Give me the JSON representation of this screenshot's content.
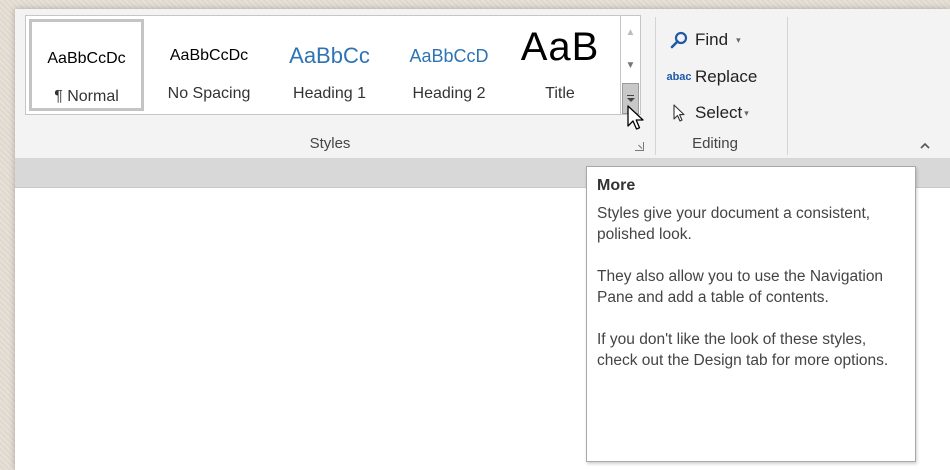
{
  "styles_gallery": {
    "tiles": [
      {
        "sample": "AaBbCcDc",
        "label": "¶ Normal",
        "selected": true
      },
      {
        "sample": "AaBbCcDc",
        "label": "No Spacing"
      },
      {
        "sample": "AaBbCc",
        "label": "Heading 1"
      },
      {
        "sample": "AaBbCcD",
        "label": "Heading 2"
      },
      {
        "sample": "AaB",
        "label": "Title"
      }
    ],
    "scroll_up_glyph": "▲",
    "scroll_down_glyph": "▼",
    "group_label": "Styles"
  },
  "editing": {
    "find_label": "Find",
    "replace_label": "Replace",
    "select_label": "Select",
    "caret_glyph": "▾",
    "replace_icon_top": "ab",
    "replace_icon_bottom": "ac",
    "group_label": "Editing"
  },
  "tooltip": {
    "title": "More",
    "paragraphs": [
      "Styles give your document a consistent, polished look.",
      "They also allow you to use the Navigation Pane and add a table of contents.",
      "If you don't like the look of these styles, check out the Design tab for more options."
    ]
  },
  "colors": {
    "heading_blue": "#2e74b5",
    "ribbon_bg": "#f3f3f3",
    "ruler_bg": "#d8d8d8"
  },
  "icons": {
    "find": "magnifier-icon",
    "replace": "replace-ab-ac-icon",
    "select": "pointer-arrow-icon",
    "more": "gallery-more-icon",
    "collapse": "chevron-up-icon",
    "launcher": "dialog-launcher-icon"
  }
}
